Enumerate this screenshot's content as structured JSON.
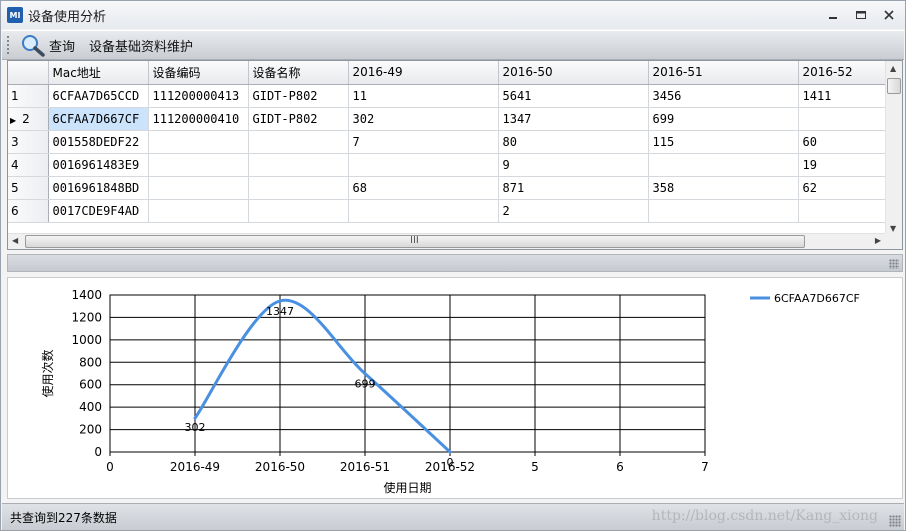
{
  "window": {
    "title": "设备使用分析",
    "icon_text": "MI"
  },
  "toolbar": {
    "query_label": "查询",
    "maintain_label": "设备基础资料维护"
  },
  "grid": {
    "columns": [
      "Mac地址",
      "设备编码",
      "设备名称",
      "2016-49",
      "2016-50",
      "2016-51",
      "2016-52"
    ],
    "rows": [
      {
        "num": "1",
        "cells": [
          "6CFAA7D65CCD",
          "111200000413",
          "GIDT-P802",
          "11",
          "5641",
          "3456",
          "1411"
        ]
      },
      {
        "num": "2",
        "cells": [
          "6CFAA7D667CF",
          "111200000410",
          "GIDT-P802",
          "302",
          "1347",
          "699",
          ""
        ]
      },
      {
        "num": "3",
        "cells": [
          "001558DEDF22",
          "",
          "",
          "7",
          "80",
          "115",
          "60"
        ]
      },
      {
        "num": "4",
        "cells": [
          "0016961483E9",
          "",
          "",
          "",
          "9",
          "",
          "19"
        ]
      },
      {
        "num": "5",
        "cells": [
          "0016961848BD",
          "",
          "",
          "68",
          "871",
          "358",
          "62"
        ]
      },
      {
        "num": "6",
        "cells": [
          "0017CDE9F4AD",
          "",
          "",
          "",
          "2",
          "",
          ""
        ]
      }
    ],
    "current_row": 1,
    "scroll_mark": "III"
  },
  "chart_data": {
    "type": "line",
    "x": [
      1,
      2,
      3,
      4
    ],
    "x_tick_values": [
      0,
      1,
      2,
      3,
      4,
      5,
      6,
      7
    ],
    "x_tick_labels": [
      "0",
      "2016-49",
      "2016-50",
      "2016-51",
      "2016-52",
      "5",
      "6",
      "7"
    ],
    "series": [
      {
        "name": "6CFAA7D667CF",
        "values": [
          302,
          1347,
          699,
          0
        ],
        "color": "#4a90e2",
        "smooth": true
      }
    ],
    "data_labels": [
      "302",
      "1347",
      "699",
      "0"
    ],
    "xlabel": "使用日期",
    "ylabel": "使用次数",
    "xlim": [
      0,
      7
    ],
    "ylim": [
      0,
      1400
    ],
    "yticks": [
      0,
      200,
      400,
      600,
      800,
      1000,
      1200,
      1400
    ],
    "grid": true,
    "legend": "top-right"
  },
  "statusbar": {
    "text": "共查询到227条数据",
    "watermark": "http://blog.csdn.net/Kang_xiong"
  }
}
